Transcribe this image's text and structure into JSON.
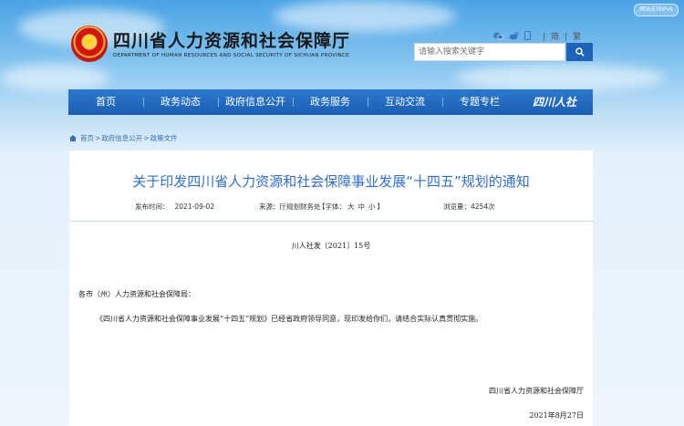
{
  "header": {
    "ipv6_badge": "网站支持IPv6",
    "site_title": "四川省人力资源和社会保障厅",
    "site_title_en": "DEPARTMENT OF HUMAN RESOURCES AND SOCIAL SECURITY OF SICHUAN PROVINCE",
    "social_icons": [
      "wechat-icon",
      "weibo-icon",
      "mobile-icon"
    ],
    "lang_simplified": "简",
    "lang_traditional": "繁",
    "lang_separator": "|",
    "search_placeholder": "请输入搜索关键字"
  },
  "nav": {
    "items": [
      "首页",
      "政务动态",
      "政府信息公开",
      "政务服务",
      "互动交流",
      "专题专栏"
    ],
    "brand": "四川人社"
  },
  "breadcrumb": {
    "items": [
      "首页",
      "政府信息公开",
      "政策文件"
    ],
    "separator": ">"
  },
  "article": {
    "title": "关于印发四川省人力资源和社会保障事业发展“十四五”规划的通知",
    "publish_label": "发布时间：",
    "publish_date": "2021-09-02",
    "source_label": "来源：",
    "source": "厅规划财务处",
    "font_label": "【字体：",
    "font_large": "大",
    "font_medium": "中",
    "font_small": "小",
    "font_close": "】",
    "views_label": "浏览量：",
    "views": "4254次",
    "doc_number": "川人社发〔2021〕15号",
    "recipient": "各市（州）人力资源和社会保障局：",
    "body": "《四川省人力资源和社会保障事业发展“十四五”规划》已经省政府领导同意，现印发给你们，请结合实际认真贯彻实施。",
    "signature": "四川省人力资源和社会保障厅",
    "date": "2021年8月27日"
  },
  "colors": {
    "nav_blue": "#1e63b8",
    "title_blue": "#2f6fd0"
  }
}
